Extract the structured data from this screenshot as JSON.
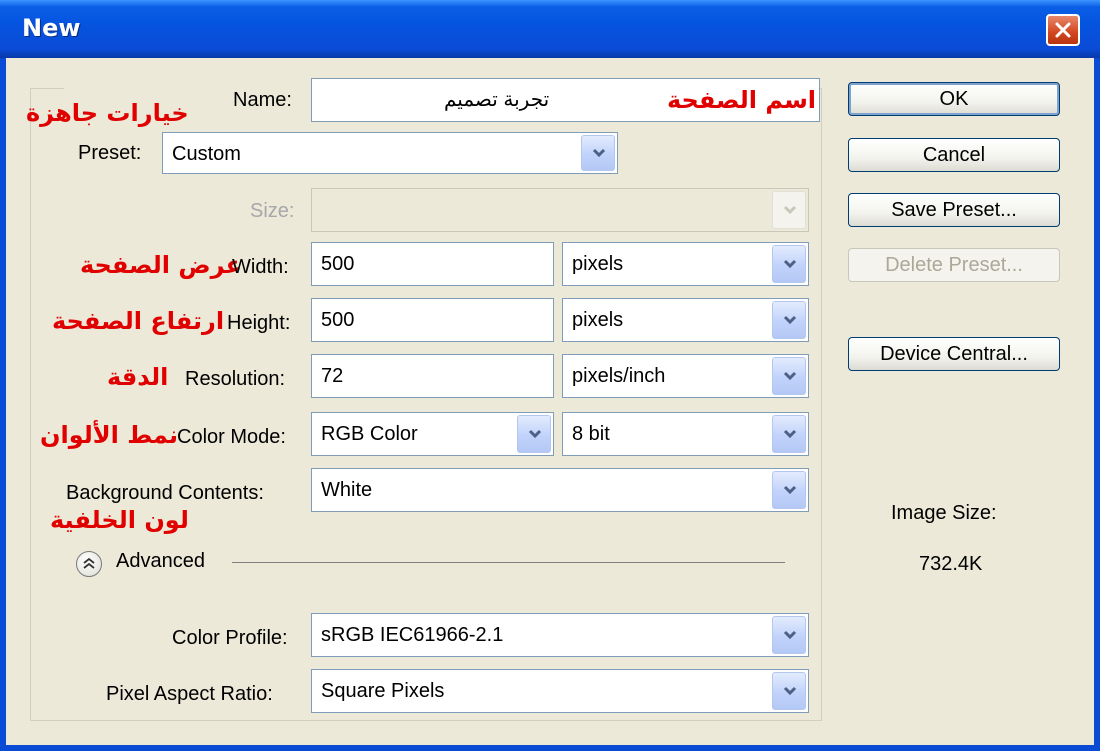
{
  "window": {
    "title": "New"
  },
  "form": {
    "name": {
      "label": "Name:",
      "value": "تجربة تصميم",
      "annotation": "اسم الصفحة"
    },
    "preset": {
      "label": "Preset:",
      "value": "Custom",
      "annotation": "خيارات جاهزة"
    },
    "size": {
      "label": "Size:",
      "value": ""
    },
    "width": {
      "label": "Width:",
      "value": "500",
      "unit": "pixels",
      "annotation": "عرض الصفحة"
    },
    "height": {
      "label": "Height:",
      "value": "500",
      "unit": "pixels",
      "annotation": "ارتفاع الصفحة"
    },
    "resolution": {
      "label": "Resolution:",
      "value": "72",
      "unit": "pixels/inch",
      "annotation": "الدقة"
    },
    "color_mode": {
      "label": "Color Mode:",
      "value": "RGB Color",
      "depth": "8 bit",
      "annotation": "نمط الألوان"
    },
    "background": {
      "label": "Background Contents:",
      "value": "White",
      "annotation": "لون الخلفية"
    },
    "advanced": {
      "label": "Advanced"
    },
    "color_profile": {
      "label": "Color Profile:",
      "value": "sRGB IEC61966-2.1"
    },
    "pixel_aspect": {
      "label": "Pixel Aspect Ratio:",
      "value": "Square Pixels"
    }
  },
  "buttons": {
    "ok": "OK",
    "cancel": "Cancel",
    "save_preset": "Save Preset...",
    "delete_preset": "Delete Preset...",
    "device_central": "Device Central..."
  },
  "image_size": {
    "label": "Image Size:",
    "value": "732.4K"
  },
  "colors": {
    "annotation": "#e00000",
    "title_bar": "#0a4bd6",
    "dialog_bg": "#ece9d8"
  }
}
